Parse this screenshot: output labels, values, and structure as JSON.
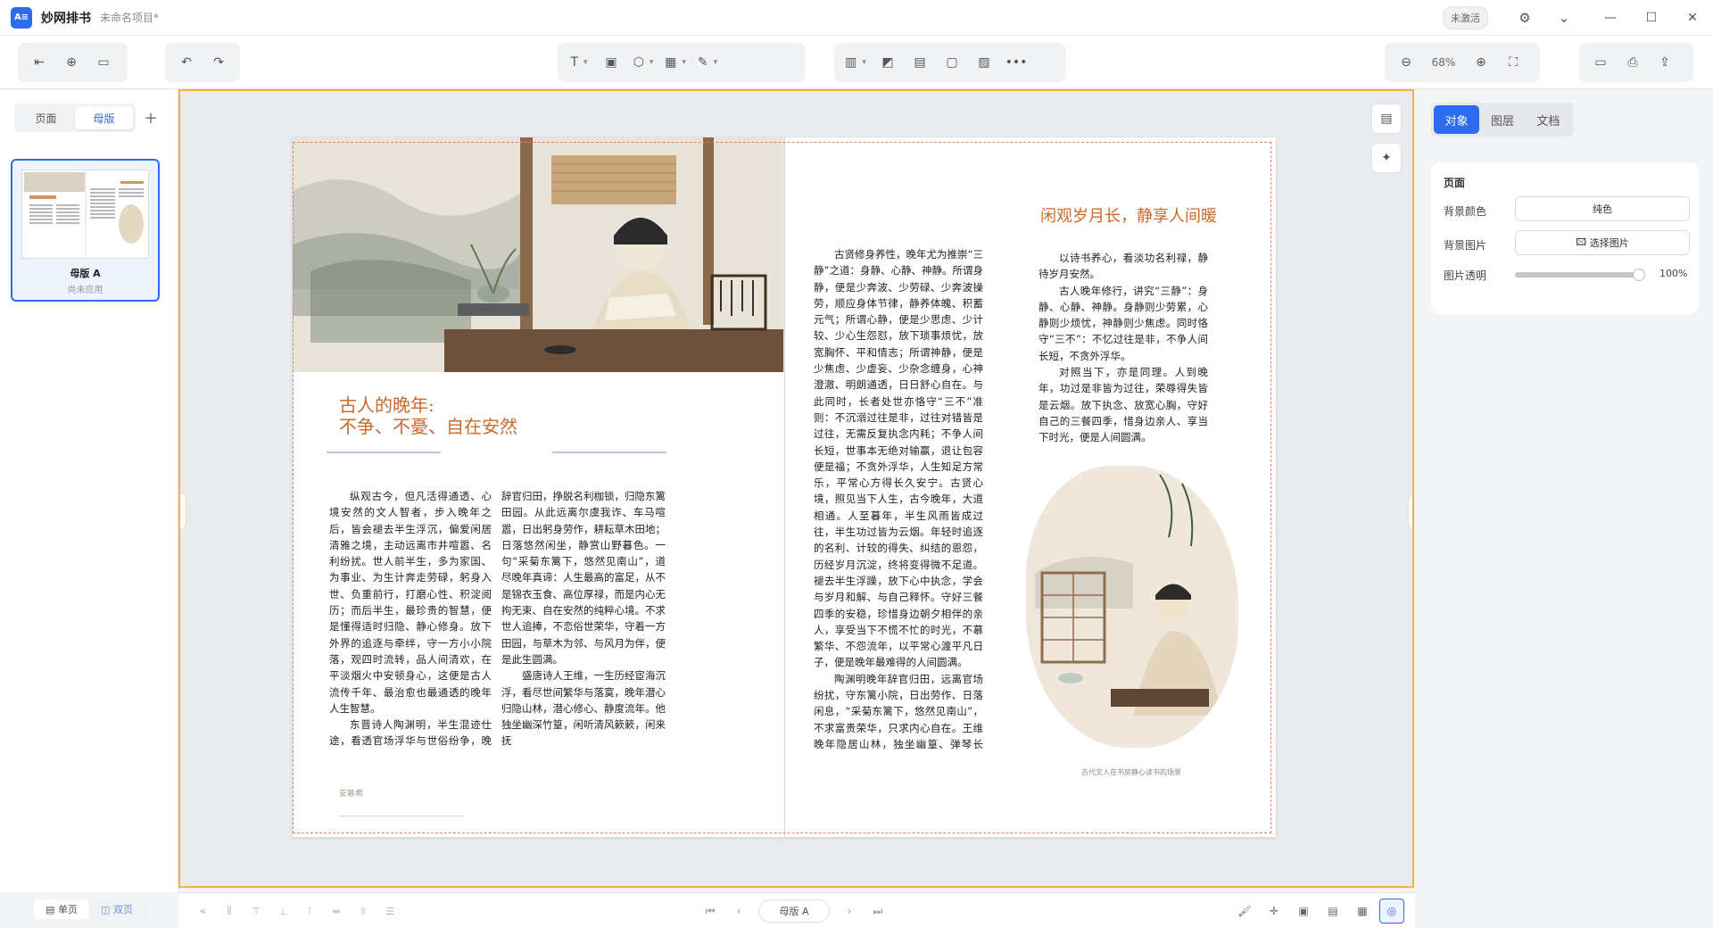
{
  "app": {
    "logo_text": "A≡",
    "name": "妙网排书",
    "project": "未命名项目*",
    "status_badge": "未激活"
  },
  "toolbar": {
    "zoom": "68%"
  },
  "left_panel": {
    "tabs": [
      "页面",
      "母版"
    ],
    "active_tab": "母版",
    "master": {
      "name": "母版 A",
      "status": "尚未应用"
    },
    "view_modes": [
      "单页",
      "双页"
    ]
  },
  "page": {
    "left_heading_line1": "古人的晚年:",
    "left_heading_line2": "不争、不憂、自在安然",
    "right_heading": "闲观岁月长，静享人间暖",
    "col1": [
      "纵观古今，但凡活得通透、心境安然的文人智者，步入晚年之后，皆会褪去半生浮沉，偏爱闲居清雅之境，主动远离市井喧嚣、名利纷扰。世人前半生，多为家国、为事业、为生计奔走劳碌，躬身入世、负重前行，打磨心性、积淀阅历；而后半生，最珍贵的智慧，便是懂得适时归隐、静心修身。放下外界的追逐与牵绊，守一方小小院落，观四时流转，品人间清欢，在平淡烟火中安顿身心，这便是古人流传千年、最治愈也最通透的晚年人生智慧。",
      "东晋诗人陶渊明，半生混迹仕途，看透官场浮华与世俗纷争，晚年毅然"
    ],
    "col2": [
      "辞官归田，挣脱名利枷锁，归隐东篱田园。从此远离尔虞我诈、车马喧嚣，日出躬身劳作，耕耘草木田地；日落悠然闲坐，静赏山野暮色。一句“采菊东篱下，悠然见南山”，道尽晚年真谛：人生最高的富足，从不是锦衣玉食、高位厚禄，而是内心无拘无束、自在安然的纯粹心境。不求世人追捧，不恋俗世荣华，守着一方田园，与草木为邻、与风月为伴，便是此生圆满。",
      "盛唐诗人王维，一生历经宦海沉浮，看尽世间繁华与落寞，晚年潜心归隐山林，潜心修心、静度流年。他独坐幽深竹篁，闲听清风簌簌，闲来抚"
    ],
    "col3": [
      "古贤修身养性，晚年尤为推崇“三静”之道：身静、心静、神静。所谓身静，便是少奔波、少劳碌、少奔波操劳，顺应身体节律，静养体魄、积蓄元气；所谓心静，便是少思虑、少计较、少心生怨怼，放下琐事烦忧，放宽胸怀、平和情志；所谓神静，便是少焦虑、少虚妄、少杂念缠身，心神澄澈、明朗通透，日日舒心自在。与此同时，长者处世亦恪守“三不”准则：不沉溺过往是非，过往对错皆是过往，无需反复执念内耗；不争人间长短，世事本无绝对输赢，退让包容便是福；不贪外浮华，人生知足方常乐，平常心方得长久安宁。古贤心境，照见当下人生，古今晚年，大道相通。人至暮年，半生风雨皆成过往，半生功过皆为云烟。年轻时追逐的名利、计较的得失、纠结的恩怨，历经岁月沉淀，终将变得微不足道。褪去半生浮躁，放下心中执念，学会与岁月和解、与自己释怀。守好三餐四季的安稳，珍惜身边朝夕相伴的亲人，享受当下不慌不忙的时光，不慕繁华、不怨流年，以平常心渡平凡日子，便是晚年最难得的人间圆满。",
      "陶渊明晚年辞官归田，远离官场纷扰，守东篱小院，日出劳作、日落闲息，“采菊东篱下，悠然见南山”，不求富贵荣华，只求内心自在。王维晚年隐居山林，独坐幽篁、弹琴长啸，以山水为伴。"
    ],
    "col4": [
      "以诗书养心，看淡功名利禄，静待岁月安然。",
      "古人晚年修行，讲究“三静”：身静、心静、神静。身静则少劳累，心静则少烦忧，神静则少焦虑。同时恪守“三不”：不忆过往是非，不争人间长短，不贪外浮华。",
      "对照当下，亦是同理。人到晚年，功过是非皆为过往，荣辱得失皆是云烟。放下执念、放宽心胸，守好自己的三餐四季，惜身边亲人、享当下时光，便是人间圆满。"
    ],
    "footer_small": "安慕希",
    "caption": "古代文人在书房静心读书的场景"
  },
  "right_panel": {
    "tabs": [
      "对象",
      "图层",
      "文档"
    ],
    "active_tab": "对象",
    "section_title": "页面",
    "bg_color_label": "背景颜色",
    "bg_color_value": "纯色",
    "bg_image_label": "背景图片",
    "bg_image_button": "选择图片",
    "opacity_label": "图片透明",
    "opacity_value": "100%",
    "opacity": 1.0
  },
  "bottom": {
    "master_label": "母版 A"
  },
  "colors": {
    "accent": "#2d6cf0",
    "canvas_border": "#f0b24a",
    "guide": "#e8826a",
    "heading": "#c96a2a"
  }
}
